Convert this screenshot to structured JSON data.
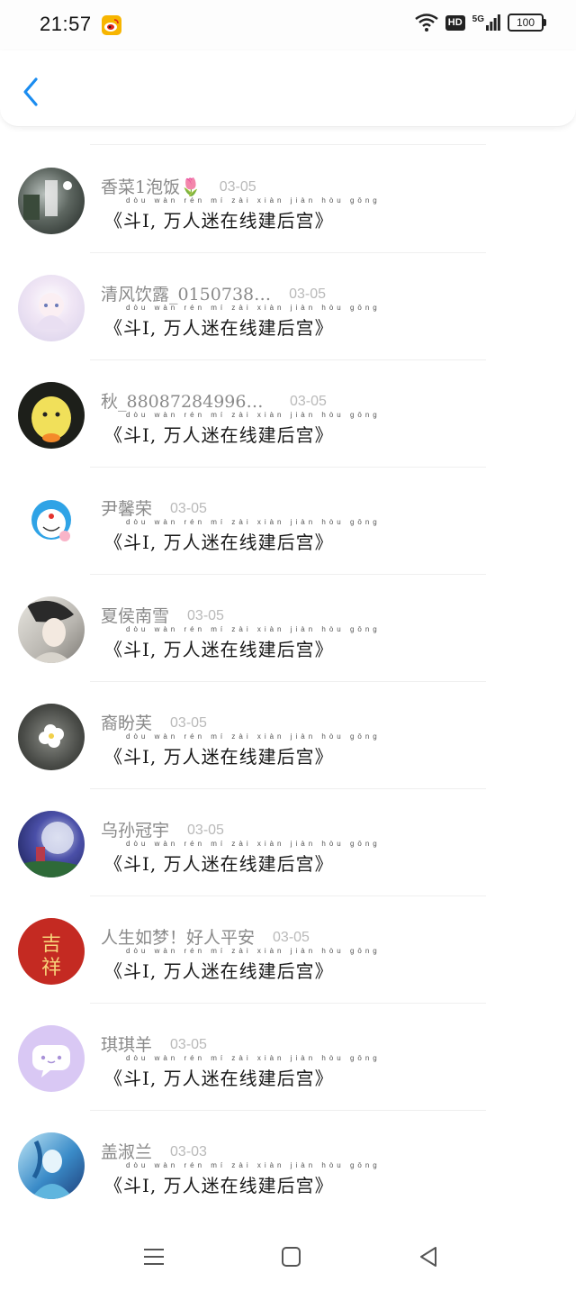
{
  "status_bar": {
    "time": "21:57",
    "hd_label": "HD",
    "network_label": "5G",
    "battery": "100"
  },
  "header": {
    "back_icon": "chevron-left-icon",
    "accent_color": "#1a8cf0"
  },
  "contacts": [
    {
      "name": "香菜1泡饭🌷",
      "date": "03-05",
      "message": "《斗I, 万人迷在线建后宫》",
      "message_pinyin": "dòu  wàn rén mí zài xiàn jiàn hòu gōng"
    },
    {
      "name": "清风饮露_0150738…",
      "date": "03-05",
      "message": "《斗I, 万人迷在线建后宫》",
      "message_pinyin": "dòu  wàn rén mí zài xiàn jiàn hòu gōng"
    },
    {
      "name": "秋_880872849969…",
      "date": "03-05",
      "message": "《斗I, 万人迷在线建后宫》",
      "message_pinyin": "dòu  wàn rén mí zài xiàn jiàn hòu gōng"
    },
    {
      "name": "尹馨荣",
      "date": "03-05",
      "message": "《斗I, 万人迷在线建后宫》",
      "message_pinyin": "dòu  wàn rén mí zài xiàn jiàn hòu gōng"
    },
    {
      "name": "夏侯南雪",
      "date": "03-05",
      "message": "《斗I, 万人迷在线建后宫》",
      "message_pinyin": "dòu  wàn rén mí zài xiàn jiàn hòu gōng"
    },
    {
      "name": "裔盼芙",
      "date": "03-05",
      "message": "《斗I, 万人迷在线建后宫》",
      "message_pinyin": "dòu  wàn rén mí zài xiàn jiàn hòu gōng"
    },
    {
      "name": "乌孙冠宇",
      "date": "03-05",
      "message": "《斗I, 万人迷在线建后宫》",
      "message_pinyin": "dòu  wàn rén mí zài xiàn jiàn hòu gōng"
    },
    {
      "name": "人生如梦！好人平安",
      "date": "03-05",
      "message": "《斗I, 万人迷在线建后宫》",
      "message_pinyin": "dòu  wàn rén mí zài xiàn jiàn hòu gōng"
    },
    {
      "name": "琪琪羊",
      "date": "03-05",
      "message": "《斗I, 万人迷在线建后宫》",
      "message_pinyin": "dòu  wàn rén mí zài xiàn jiàn hòu gōng"
    },
    {
      "name": "盖淑兰",
      "date": "03-03",
      "message": "《斗I, 万人迷在线建后宫》",
      "message_pinyin": "dòu  wàn rén mí zài xiàn jiàn hòu gōng"
    }
  ],
  "nav_bar": {
    "menu_icon": "menu-icon",
    "home_icon": "home-square-icon",
    "back_icon": "back-triangle-icon"
  }
}
